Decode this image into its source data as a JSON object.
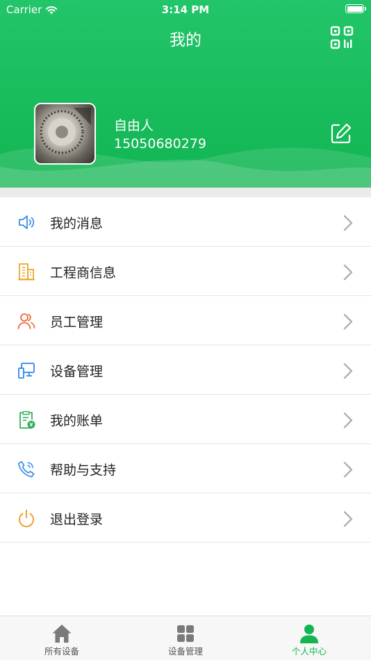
{
  "status_bar": {
    "carrier": "Carrier",
    "time": "3:14 PM"
  },
  "header": {
    "title": "我的"
  },
  "profile": {
    "name": "自由人",
    "phone": "15050680279"
  },
  "menu": {
    "items": [
      {
        "label": "我的消息",
        "icon": "speaker-icon",
        "color": "#3a8ee6"
      },
      {
        "label": "工程商信息",
        "icon": "building-icon",
        "color": "#e7a92c"
      },
      {
        "label": "员工管理",
        "icon": "users-icon",
        "color": "#ec6a3b"
      },
      {
        "label": "设备管理",
        "icon": "computer-icon",
        "color": "#2f86e8"
      },
      {
        "label": "我的账单",
        "icon": "bill-icon",
        "color": "#2fae5a"
      },
      {
        "label": "帮助与支持",
        "icon": "phone-icon",
        "color": "#3a8ee6"
      },
      {
        "label": "退出登录",
        "icon": "power-icon",
        "color": "#f0a030"
      }
    ]
  },
  "tabbar": {
    "tabs": [
      {
        "label": "所有设备",
        "icon": "home-icon",
        "active": false
      },
      {
        "label": "设备管理",
        "icon": "grid-icon",
        "active": false
      },
      {
        "label": "个人中心",
        "icon": "person-icon",
        "active": true
      }
    ]
  },
  "colors": {
    "brand_green": "#12b552",
    "chevron": "#b0b0b0",
    "tab_inactive": "#777777"
  }
}
